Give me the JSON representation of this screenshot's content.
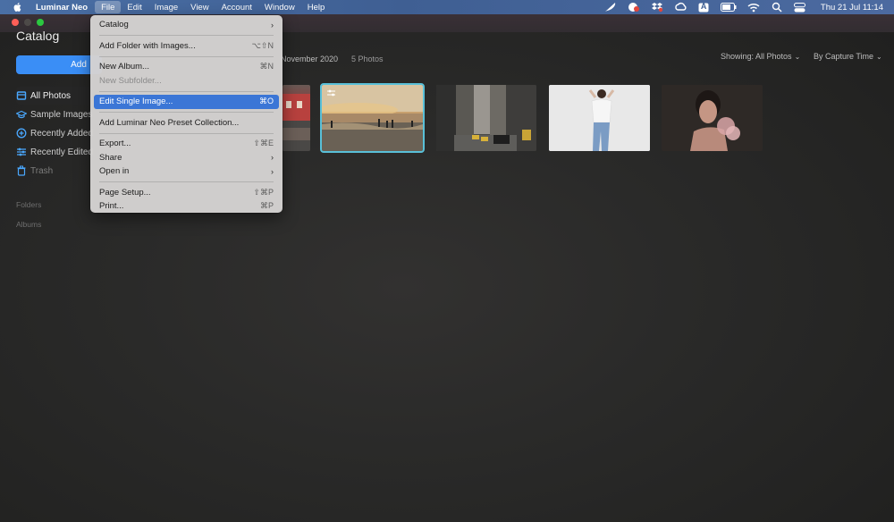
{
  "menubar": {
    "app_name": "Luminar Neo",
    "items": [
      "File",
      "Edit",
      "Image",
      "View",
      "Account",
      "Window",
      "Help"
    ],
    "active_item": "File",
    "status_icons": [
      "feather-icon",
      "notification-badge-icon",
      "dropbox-icon",
      "creative-cloud-icon",
      "keyboard-input-icon",
      "battery-icon",
      "wifi-icon",
      "search-icon",
      "control-center-icon"
    ],
    "input_source": "A",
    "clock": "Thu 21 Jul  11:14"
  },
  "sidebar": {
    "title": "Catalog",
    "add_button": "Add",
    "items": [
      {
        "label": "All Photos",
        "icon": "photos-icon"
      },
      {
        "label": "Sample Images",
        "icon": "graduation-cap-icon"
      },
      {
        "label": "Recently Added",
        "icon": "plus-circle-icon"
      },
      {
        "label": "Recently Edited",
        "icon": "sliders-icon"
      },
      {
        "label": "Trash",
        "icon": "trash-icon"
      }
    ],
    "sections": [
      "Folders",
      "Albums"
    ]
  },
  "content": {
    "date_label": "November 2020",
    "count_label": "5 Photos",
    "showing_label": "Showing: All Photos",
    "sort_label": "By Capture Time"
  },
  "file_menu": {
    "items": [
      {
        "label": "Catalog",
        "shortcut": "",
        "submenu": true
      },
      {
        "sep": true
      },
      {
        "label": "Add Folder with Images...",
        "shortcut": "⌥⇧N"
      },
      {
        "sep": true
      },
      {
        "label": "New Album...",
        "shortcut": "⌘N"
      },
      {
        "label": "New Subfolder...",
        "shortcut": "",
        "disabled": true
      },
      {
        "sep": true
      },
      {
        "label": "Edit Single Image...",
        "shortcut": "⌘O",
        "highlighted": true
      },
      {
        "sep": true
      },
      {
        "label": "Add Luminar Neo Preset Collection...",
        "shortcut": ""
      },
      {
        "sep": true
      },
      {
        "label": "Export...",
        "shortcut": "⇧⌘E"
      },
      {
        "label": "Share",
        "shortcut": "",
        "submenu": true
      },
      {
        "label": "Open in",
        "shortcut": "",
        "submenu": true
      },
      {
        "sep": true
      },
      {
        "label": "Page Setup...",
        "shortcut": "⇧⌘P"
      },
      {
        "label": "Print...",
        "shortcut": "⌘P"
      }
    ]
  },
  "colors": {
    "accent": "#3a8ef6",
    "menu_highlight": "#3b76d6",
    "selection_outline": "#59c0d8"
  }
}
